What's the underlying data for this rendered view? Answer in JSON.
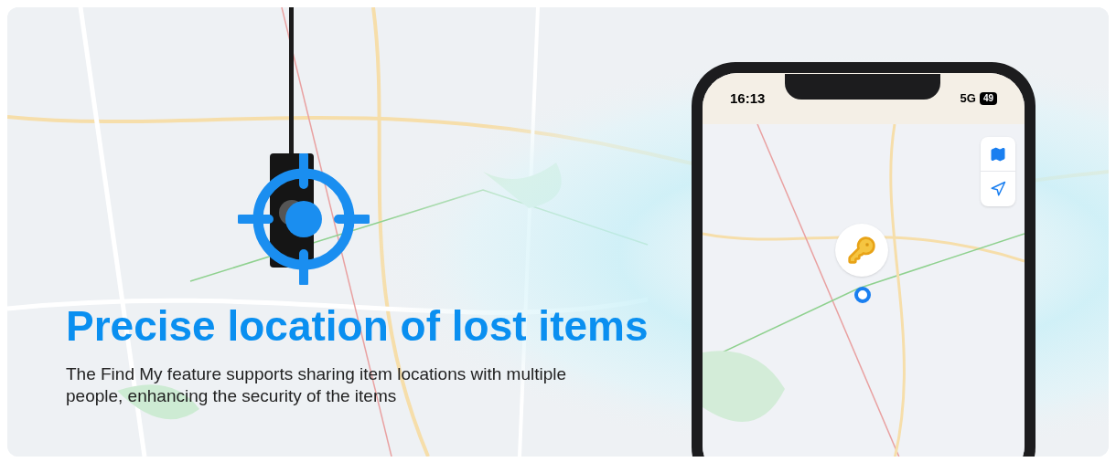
{
  "headline": "Precise location of lost items",
  "description": "The Find My feature supports sharing item locations with multiple people, enhancing the security of the items",
  "phone": {
    "time": "16:13",
    "network": "5G",
    "battery": "49"
  }
}
